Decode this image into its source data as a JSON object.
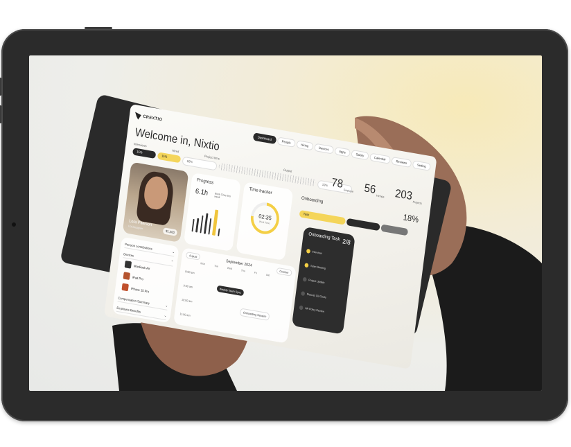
{
  "colors": {
    "device_frame": "#2b2b2b",
    "accent": "#f4cf45",
    "dark": "#2a2a2a"
  },
  "app": {
    "brand": "CREXTIO",
    "nav": [
      "Dashboard",
      "People",
      "Hiring",
      "Devices",
      "Apps",
      "Salary",
      "Calendar",
      "Reviews",
      "Setting"
    ],
    "welcome": "Welcome in, Nixtio",
    "stat_labels": [
      "Interviews",
      "Hired",
      "Project time",
      "Output"
    ],
    "pill_labels": [
      "15%",
      "15%",
      "60%",
      "10%"
    ],
    "counters": [
      {
        "num": "78",
        "label": "Employe"
      },
      {
        "num": "56",
        "label": "Hirings"
      },
      {
        "num": "203",
        "label": "Projects"
      }
    ],
    "profile": {
      "name": "Lora Piterson",
      "role": "UX Designer",
      "salary": "$1,200"
    },
    "progress": {
      "title": "Progress",
      "value": "6.1h",
      "sub": "Work Time this week",
      "days": [
        "S",
        "M",
        "T",
        "W",
        "T",
        "F",
        "S"
      ],
      "highlight_label": "5h 23m",
      "bar_levels": [
        0.5,
        0.55,
        0.7,
        0.8,
        0.65,
        1.0,
        0.3
      ]
    },
    "timer": {
      "title": "Time tracker",
      "value": "02:35",
      "sub": "Work Time",
      "fill": 0.75
    },
    "onboarding": {
      "title": "Onboarding",
      "percent": "18%",
      "bar_labels": [
        "30%",
        "25%",
        "0%"
      ],
      "task_label": "Task"
    },
    "task_card": {
      "title": "Onboarding Task",
      "count": "2/8",
      "items": [
        {
          "label": "Interview",
          "done": true
        },
        {
          "label": "Team Meeting",
          "done": true
        },
        {
          "label": "Project Update",
          "done": false
        },
        {
          "label": "Discuss Q3 Goals",
          "done": false
        },
        {
          "label": "HR Policy Review",
          "done": false
        }
      ]
    },
    "accordion": {
      "pension": "Pension contributions",
      "devices": "Devices",
      "device_items": [
        {
          "name": "MacBook Air",
          "sub": "Version M1"
        },
        {
          "name": "iPad Pro",
          "sub": "Silver"
        },
        {
          "name": "iPhone 15 Pro",
          "sub": "128GB"
        }
      ],
      "compensation": "Compensation Summary",
      "benefits": "Employee Benefits"
    },
    "calendar": {
      "month": "September 2024",
      "left_pill": "August",
      "right_pill": "October",
      "days": [
        "Mon",
        "Tue",
        "Wed",
        "Thu",
        "Fri",
        "Sat"
      ],
      "times": [
        "8:00 am",
        "9:00 am",
        "10:00 am",
        "11:00 am"
      ],
      "events": [
        {
          "title": "Weekly Team Sync",
          "dark": true
        },
        {
          "title": "Onboarding Session",
          "dark": false
        }
      ]
    }
  }
}
